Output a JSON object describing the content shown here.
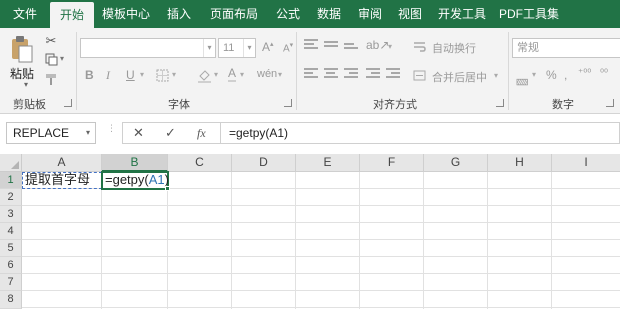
{
  "tabs": [
    "文件",
    "开始",
    "模板中心",
    "插入",
    "页面布局",
    "公式",
    "数据",
    "审阅",
    "视图",
    "开发工具",
    "PDF工具集"
  ],
  "active_tab": "开始",
  "ribbon": {
    "clipboard": {
      "paste_label": "粘贴",
      "group_label": "剪贴板"
    },
    "font": {
      "font_size": "11",
      "group_label": "字体"
    },
    "alignment": {
      "wrap_text": "自动换行",
      "merge_center": "合并后居中",
      "group_label": "对齐方式"
    },
    "number": {
      "format": "常规",
      "group_label": "数字"
    }
  },
  "formula_bar": {
    "name_box": "REPLACE",
    "cancel_symbol": "✕",
    "enter_symbol": "✓",
    "fx_symbol": "fx",
    "formula": "=getpy(A1)"
  },
  "grid": {
    "columns": [
      "A",
      "B",
      "C",
      "D",
      "E",
      "F",
      "G",
      "H",
      "I"
    ],
    "rows": [
      "1",
      "2",
      "3",
      "4",
      "5",
      "6",
      "7",
      "8"
    ],
    "a1_value": "提取首字母",
    "b1_prefix": "=getpy(",
    "b1_ref": "A1",
    "b1_suffix": ")"
  },
  "colors": {
    "brand": "#217346",
    "reference": "#2f75b5"
  }
}
